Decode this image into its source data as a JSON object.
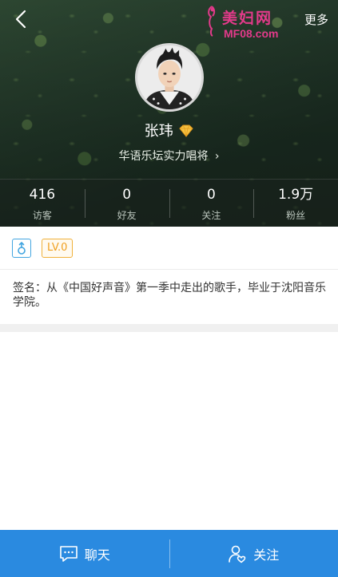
{
  "header": {
    "more_label": "更多",
    "watermark_cn": "美妇网",
    "watermark_en": "MF08.com"
  },
  "profile": {
    "name": "张玮",
    "title": "华语乐坛实力唱将",
    "vip_icon": "diamond-icon",
    "avatar_icon": "avatar-photo"
  },
  "stats": [
    {
      "value": "416",
      "label": "访客"
    },
    {
      "value": "0",
      "label": "好友"
    },
    {
      "value": "0",
      "label": "关注"
    },
    {
      "value": "1.9万",
      "label": "粉丝"
    }
  ],
  "badges": {
    "gender_icon": "male-icon",
    "level": "LV.0"
  },
  "signature": {
    "label": "签名：",
    "text": "从《中国好声音》第一季中走出的歌手，毕业于沈阳音乐学院。"
  },
  "bottom_bar": {
    "chat_label": "聊天",
    "follow_label": "关注"
  },
  "colors": {
    "accent": "#2a8ae0",
    "level": "#f0a020",
    "gender": "#42a5e0",
    "watermark": "#e23a8a"
  }
}
